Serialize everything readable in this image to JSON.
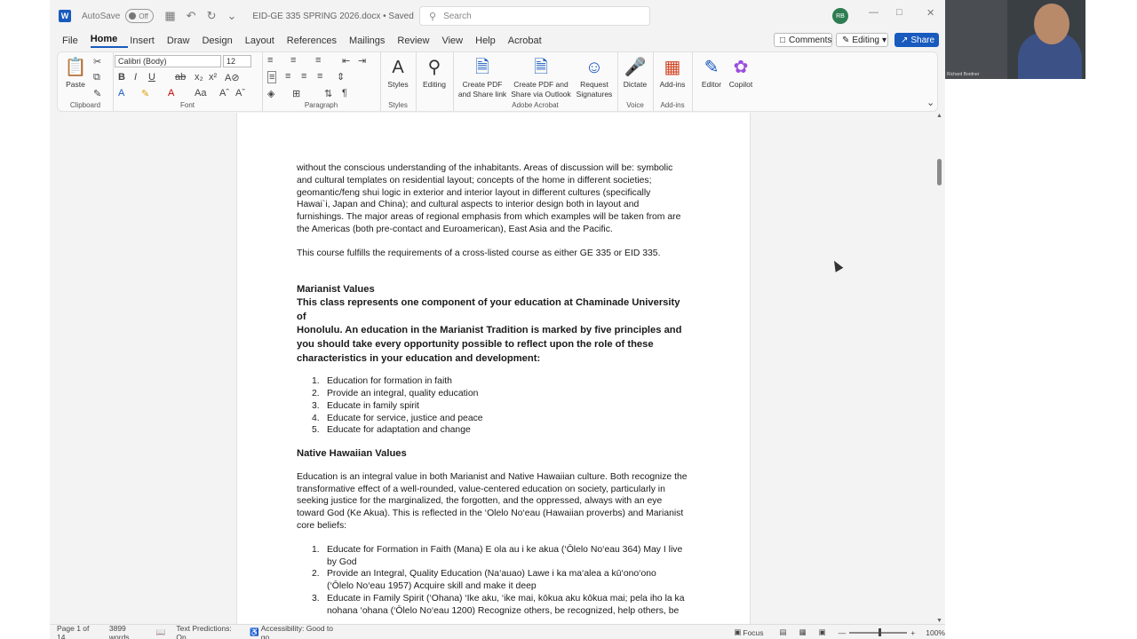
{
  "title_bar": {
    "autosave_label": "AutoSave",
    "autosave_state": "Off",
    "document_title": "EID-GE 335 SPRING 2026.docx • Saved",
    "search_placeholder": "Search",
    "user_initials": "RB"
  },
  "menu": {
    "tabs": [
      "File",
      "Home",
      "Insert",
      "Draw",
      "Design",
      "Layout",
      "References",
      "Mailings",
      "Review",
      "View",
      "Help",
      "Acrobat"
    ],
    "active_tab": "Home",
    "comments_label": "Comments",
    "editing_label": "Editing",
    "share_label": "Share"
  },
  "ribbon": {
    "clipboard": {
      "paste_label": "Paste",
      "group_label": "Clipboard"
    },
    "font": {
      "font_name": "Calibri (Body)",
      "font_size": "12",
      "group_label": "Font"
    },
    "paragraph": {
      "group_label": "Paragraph"
    },
    "styles": {
      "button_label": "Styles",
      "group_label": "Styles"
    },
    "editing": {
      "button_label": "Editing"
    },
    "acrobat": {
      "create_share_line1": "Create PDF",
      "create_share_line2": "and Share link",
      "create_outlook_line1": "Create PDF and",
      "create_outlook_line2": "Share via Outlook",
      "request_line1": "Request",
      "request_line2": "Signatures",
      "group_label": "Adobe Acrobat"
    },
    "voice": {
      "dictate_label": "Dictate",
      "group_label": "Voice"
    },
    "addins": {
      "button_label": "Add-ins",
      "group_label": "Add-ins"
    },
    "editor_label": "Editor",
    "copilot_label": "Copilot"
  },
  "document": {
    "intro_lines": [
      "without the conscious understanding of the inhabitants.  Areas of discussion will be: symbolic",
      "and cultural templates on residential layout; concepts of the home in different societies;",
      "geomantic/feng shui logic in exterior and interior layout in different cultures (specifically",
      "Hawai`i, Japan and China); and cultural aspects to interior design both in layout and",
      "furnishings.  The major areas of regional emphasis from which examples will be taken from are",
      "the Americas (both pre-contact and Euroamerican), East Asia and the Pacific."
    ],
    "crosslisted": "This course fulfills the requirements of a cross-listed course as either GE 335 or EID 335.",
    "marianist_heading": "Marianist Values",
    "marianist_lines": [
      "This class represents one component of your education at Chaminade University of",
      "Honolulu. An education in the Marianist Tradition is marked by five principles and",
      "you should take every opportunity possible to reflect upon the role of these",
      "characteristics in your education and development:"
    ],
    "marianist_list": [
      {
        "num": "1.",
        "text": "Education for formation in faith"
      },
      {
        "num": "2.",
        "text": "Provide an integral, quality education"
      },
      {
        "num": "3.",
        "text": "Educate in family spirit"
      },
      {
        "num": "4.",
        "text": "Educate for service, justice and peace"
      },
      {
        "num": "5.",
        "text": "Educate for adaptation and change"
      }
    ],
    "hawaiian_heading": "Native Hawaiian Values",
    "hawaiian_lines": [
      "Education is an integral value in both Marianist and Native Hawaiian culture. Both recognize the",
      "transformative effect of a well-rounded, value-centered education on society, particularly in",
      "seeking justice for the marginalized, the forgotten, and the oppressed, always with an eye",
      "toward God (Ke Akua). This is reflected in the ‘Olelo No‘eau (Hawaiian proverbs) and Marianist",
      "core beliefs:"
    ],
    "hawaiian_list": [
      {
        "num": "1.",
        "line1": "Educate for Formation in Faith (Mana) E ola au i ke akua (‘Ōlelo No‘eau 364) May I live",
        "line2": "by God"
      },
      {
        "num": "2.",
        "line1": "Provide an Integral, Quality Education (Na‘auao) Lawe i ka ma‘alea a kū‘ono‘ono",
        "line2": "(‘Ōlelo  No‘eau 1957) Acquire skill and make it deep"
      },
      {
        "num": "3.",
        "line1": "Educate in Family Spirit (‘Ohana) ‘Ike aku, ‘ike mai, kōkua aku kōkua mai; pela iho la ka",
        "line2": "nohana ‘ohana (‘Ōlelo No‘eau 1200) Recognize others, be recognized, help others, be"
      }
    ]
  },
  "status_bar": {
    "page": "Page 1 of 14",
    "words": "3899 words",
    "predictions": "Text Predictions: On",
    "accessibility": "Accessibility: Good to go",
    "focus": "Focus",
    "zoom": "100%"
  },
  "video": {
    "participant_name": "Richard Bordner"
  }
}
